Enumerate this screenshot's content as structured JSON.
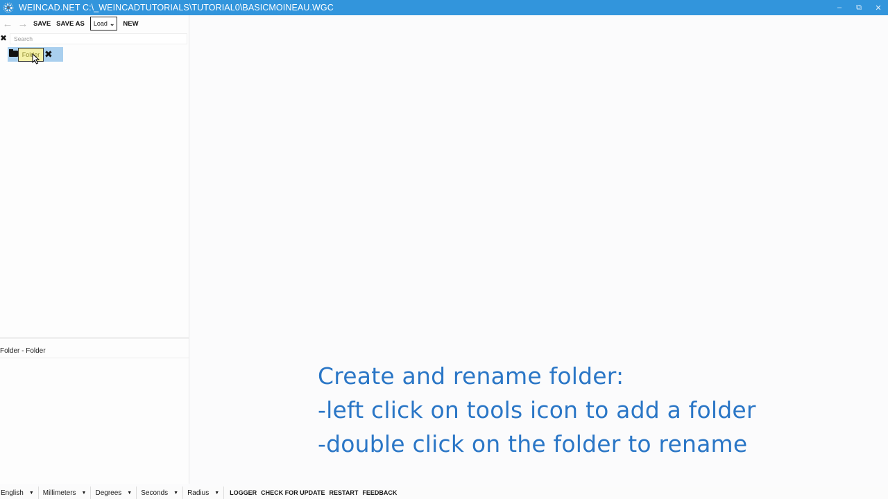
{
  "window": {
    "title": "WEINCAD.NET C:\\_WEINCADTUTORIALS\\TUTORIAL0\\BASICMOINEAU.WGC",
    "icon": "gear-icon",
    "minimize": "–",
    "restore": "⧉",
    "close": "✕",
    "titlebar_color": "#3295dc"
  },
  "toolbar": {
    "back": "←",
    "forward": "→",
    "save_label": "SAVE",
    "save_as_label": "SAVE AS",
    "load_label": "Load",
    "new_label": "NEW"
  },
  "search": {
    "placeholder": "Search"
  },
  "tree": {
    "node_label": "Folder",
    "node_icon": "folder-icon",
    "tools_icon": "tools-icon",
    "selection_color": "#a9cfee"
  },
  "properties": {
    "header": "Folder  -  Folder"
  },
  "instructions": {
    "line1": "Create and rename folder:",
    "line2": "-left click on tools icon to add a folder",
    "line3": "-double click on the folder to rename",
    "color": "#2a76c6"
  },
  "statusbar": {
    "language": "English",
    "units_length": "Millimeters",
    "units_angle": "Degrees",
    "units_time": "Seconds",
    "arc_mode": "Radius",
    "logger_label": "LOGGER",
    "check_update_label": "CHECK FOR UPDATE",
    "restart_label": "RESTART",
    "feedback_label": "FEEDBACK"
  }
}
